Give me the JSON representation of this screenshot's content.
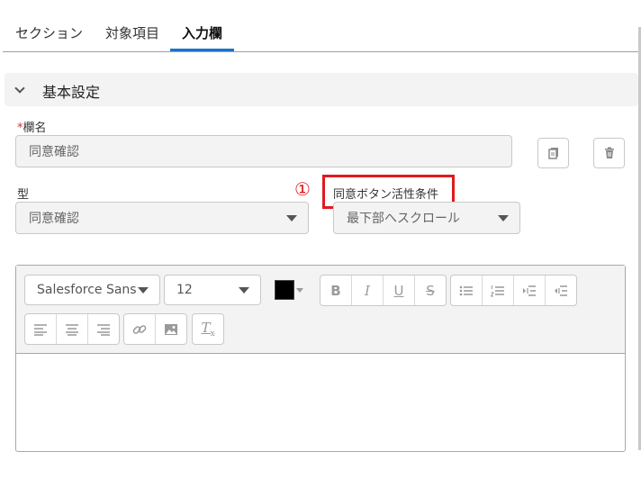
{
  "tabs": [
    {
      "label": "セクション"
    },
    {
      "label": "対象項目"
    },
    {
      "label": "入力欄"
    }
  ],
  "section": {
    "title": "基本設定"
  },
  "field_name": {
    "required_mark": "*",
    "label": "欄名",
    "value": "同意確認"
  },
  "type_field": {
    "label": "型",
    "value": "同意確認"
  },
  "consent_condition": {
    "annotation": "①",
    "label": "同意ボタン活性条件",
    "value": "最下部へスクロール"
  },
  "editor": {
    "font_family": "Salesforce Sans",
    "font_size": "12",
    "text_color": "#000000",
    "clear_format_glyph": "T",
    "clear_format_sub": "x",
    "bold_glyph": "B",
    "italic_glyph": "I",
    "underline_glyph": "U",
    "strike_glyph": "S"
  }
}
